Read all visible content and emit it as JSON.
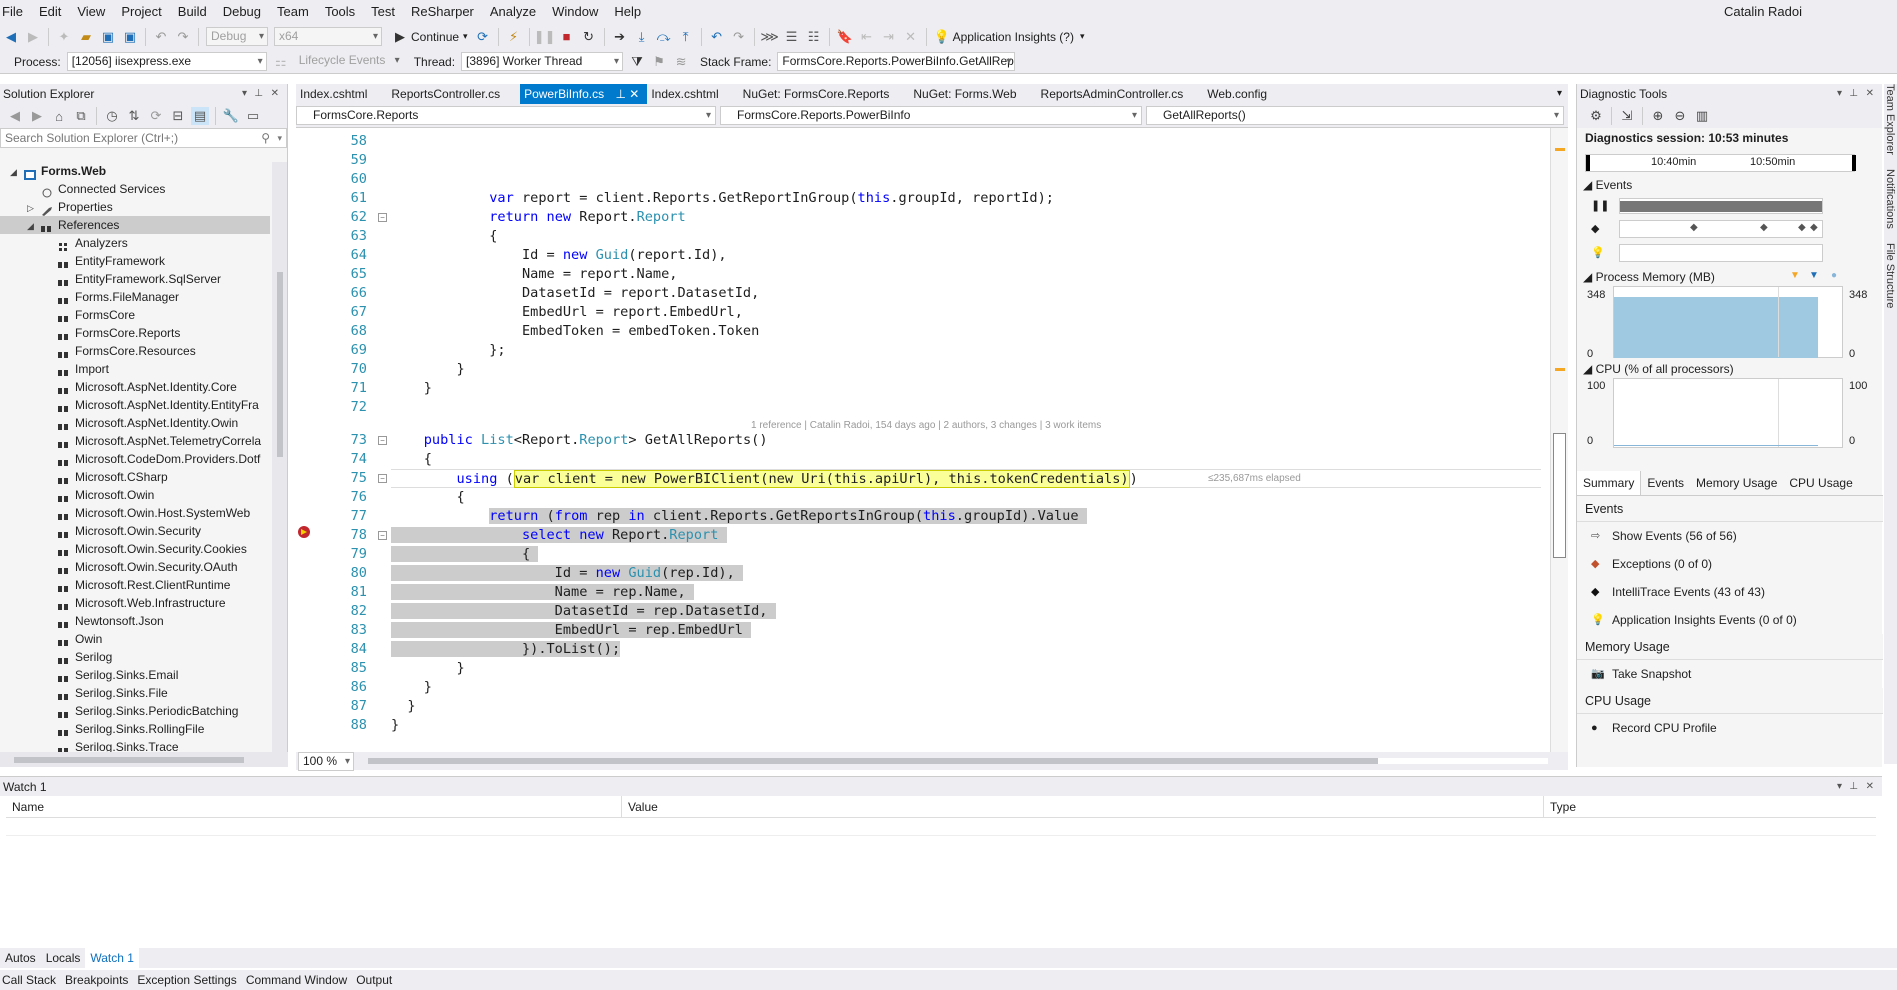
{
  "menu": [
    "File",
    "Edit",
    "View",
    "Project",
    "Build",
    "Debug",
    "Team",
    "Tools",
    "Test",
    "ReSharper",
    "Analyze",
    "Window",
    "Help"
  ],
  "user": "Catalin Radoi",
  "toolbar": {
    "config": "Debug",
    "platform": "x64",
    "continue_label": "Continue",
    "app_insights": "Application Insights (?)",
    "process_label": "Process:",
    "process_value": "[12056] iisexpress.exe",
    "lifecycle": "Lifecycle Events",
    "thread_label": "Thread:",
    "thread_value": "[3896] Worker Thread",
    "stack_label": "Stack Frame:",
    "stack_value": "FormsCore.Reports.PowerBiInfo.GetAllRep"
  },
  "solution_explorer": {
    "title": "Solution Explorer",
    "search_placeholder": "Search Solution Explorer (Ctrl+;)",
    "nodes": [
      {
        "label": "Forms.Web",
        "level": 0,
        "bold": true,
        "icon": "project-icon"
      },
      {
        "label": "Connected Services",
        "level": 1,
        "icon": "connected-services-icon"
      },
      {
        "label": "Properties",
        "level": 1,
        "icon": "properties-icon"
      },
      {
        "label": "References",
        "level": 1,
        "icon": "references-icon",
        "selected": true
      },
      {
        "label": "Analyzers",
        "level": 2,
        "icon": "analyzer-icon"
      },
      {
        "label": "EntityFramework",
        "level": 2,
        "icon": "reference-icon"
      },
      {
        "label": "EntityFramework.SqlServer",
        "level": 2,
        "icon": "reference-icon"
      },
      {
        "label": "Forms.FileManager",
        "level": 2,
        "icon": "reference-icon"
      },
      {
        "label": "FormsCore",
        "level": 2,
        "icon": "reference-icon"
      },
      {
        "label": "FormsCore.Reports",
        "level": 2,
        "icon": "reference-icon"
      },
      {
        "label": "FormsCore.Resources",
        "level": 2,
        "icon": "reference-icon"
      },
      {
        "label": "Import",
        "level": 2,
        "icon": "reference-icon"
      },
      {
        "label": "Microsoft.AspNet.Identity.Core",
        "level": 2,
        "icon": "reference-icon"
      },
      {
        "label": "Microsoft.AspNet.Identity.EntityFra",
        "level": 2,
        "icon": "reference-icon"
      },
      {
        "label": "Microsoft.AspNet.Identity.Owin",
        "level": 2,
        "icon": "reference-icon"
      },
      {
        "label": "Microsoft.AspNet.TelemetryCorrela",
        "level": 2,
        "icon": "reference-icon"
      },
      {
        "label": "Microsoft.CodeDom.Providers.Dotf",
        "level": 2,
        "icon": "reference-icon"
      },
      {
        "label": "Microsoft.CSharp",
        "level": 2,
        "icon": "reference-icon"
      },
      {
        "label": "Microsoft.Owin",
        "level": 2,
        "icon": "reference-icon"
      },
      {
        "label": "Microsoft.Owin.Host.SystemWeb",
        "level": 2,
        "icon": "reference-icon"
      },
      {
        "label": "Microsoft.Owin.Security",
        "level": 2,
        "icon": "reference-icon"
      },
      {
        "label": "Microsoft.Owin.Security.Cookies",
        "level": 2,
        "icon": "reference-icon"
      },
      {
        "label": "Microsoft.Owin.Security.OAuth",
        "level": 2,
        "icon": "reference-icon"
      },
      {
        "label": "Microsoft.Rest.ClientRuntime",
        "level": 2,
        "icon": "reference-icon"
      },
      {
        "label": "Microsoft.Web.Infrastructure",
        "level": 2,
        "icon": "reference-icon"
      },
      {
        "label": "Newtonsoft.Json",
        "level": 2,
        "icon": "reference-icon"
      },
      {
        "label": "Owin",
        "level": 2,
        "icon": "reference-icon"
      },
      {
        "label": "Serilog",
        "level": 2,
        "icon": "reference-icon"
      },
      {
        "label": "Serilog.Sinks.Email",
        "level": 2,
        "icon": "reference-icon"
      },
      {
        "label": "Serilog.Sinks.File",
        "level": 2,
        "icon": "reference-icon"
      },
      {
        "label": "Serilog.Sinks.PeriodicBatching",
        "level": 2,
        "icon": "reference-icon"
      },
      {
        "label": "Serilog.Sinks.RollingFile",
        "level": 2,
        "icon": "reference-icon"
      },
      {
        "label": "Serilog.Sinks.Trace",
        "level": 2,
        "icon": "reference-icon"
      }
    ]
  },
  "tabs": [
    "Index.cshtml",
    "ReportsController.cs",
    "PowerBiInfo.cs",
    "Index.cshtml",
    "NuGet: FormsCore.Reports",
    "NuGet: Forms.Web",
    "ReportsAdminController.cs",
    "Web.config"
  ],
  "active_tab": 2,
  "nav": {
    "project": "FormsCore.Reports",
    "class": "FormsCore.Reports.PowerBiInfo",
    "member": "GetAllReports()"
  },
  "code": [
    {
      "n": "58",
      "tokens": []
    },
    {
      "n": "59",
      "tokens": []
    },
    {
      "n": "60",
      "tokens": []
    },
    {
      "n": "61",
      "tokens": [
        [
          "t",
          "            "
        ],
        [
          "k",
          "var"
        ],
        [
          "t",
          " report = client.Reports.GetReportInGroup("
        ],
        [
          "k",
          "this"
        ],
        [
          "t",
          ".groupId, reportId);"
        ]
      ]
    },
    {
      "n": "62",
      "tokens": [
        [
          "t",
          "            "
        ],
        [
          "k",
          "return"
        ],
        [
          "t",
          " "
        ],
        [
          "k",
          "new"
        ],
        [
          "t",
          " Report."
        ],
        [
          "y",
          "Report"
        ]
      ]
    },
    {
      "n": "63",
      "tokens": [
        [
          "t",
          "            {"
        ]
      ]
    },
    {
      "n": "64",
      "tokens": [
        [
          "t",
          "                Id = "
        ],
        [
          "k",
          "new"
        ],
        [
          "t",
          " "
        ],
        [
          "y",
          "Guid"
        ],
        [
          "t",
          "(report.Id),"
        ]
      ]
    },
    {
      "n": "65",
      "tokens": [
        [
          "t",
          "                Name = report.Name,"
        ]
      ]
    },
    {
      "n": "66",
      "tokens": [
        [
          "t",
          "                DatasetId = report.DatasetId,"
        ]
      ]
    },
    {
      "n": "67",
      "tokens": [
        [
          "t",
          "                EmbedUrl = report.EmbedUrl,"
        ]
      ]
    },
    {
      "n": "68",
      "tokens": [
        [
          "t",
          "                EmbedToken = embedToken.Token"
        ]
      ]
    },
    {
      "n": "69",
      "tokens": [
        [
          "t",
          "            };"
        ]
      ]
    },
    {
      "n": "70",
      "tokens": [
        [
          "t",
          "        }"
        ]
      ]
    },
    {
      "n": "71",
      "tokens": [
        [
          "t",
          "    }"
        ]
      ]
    },
    {
      "n": "72",
      "tokens": []
    },
    {
      "n": "73",
      "tokens": [
        [
          "t",
          "    "
        ],
        [
          "k",
          "public"
        ],
        [
          "t",
          " "
        ],
        [
          "y",
          "List"
        ],
        [
          "t",
          "<Report."
        ],
        [
          "y",
          "Report"
        ],
        [
          "t",
          "> GetAllReports()"
        ]
      ]
    },
    {
      "n": "74",
      "tokens": [
        [
          "t",
          "    {"
        ]
      ]
    },
    {
      "n": "75",
      "tokens": [
        [
          "t",
          "        "
        ],
        [
          "k",
          "using"
        ],
        [
          "t",
          " ("
        ],
        [
          "c",
          "var client = new PowerBIClient(new Uri(this.apiUrl), this.tokenCredentials)"
        ],
        [
          "t",
          ")"
        ]
      ]
    },
    {
      "n": "76",
      "tokens": [
        [
          "t",
          "        {"
        ]
      ]
    },
    {
      "n": "77",
      "tokens": [
        [
          "t",
          "            "
        ],
        [
          "hk",
          "return"
        ],
        [
          "h",
          " ("
        ],
        [
          "hk",
          "from"
        ],
        [
          "h",
          " rep "
        ],
        [
          "hk",
          "in"
        ],
        [
          "h",
          " client.Reports.GetReportsInGroup("
        ],
        [
          "hk",
          "this"
        ],
        [
          "h",
          ".groupId).Value "
        ]
      ]
    },
    {
      "n": "78",
      "tokens": [
        [
          "h",
          "                "
        ],
        [
          "hk",
          "select"
        ],
        [
          "h",
          " "
        ],
        [
          "hk",
          "new"
        ],
        [
          "h",
          " Report."
        ],
        [
          "hy",
          "Report"
        ],
        [
          "h",
          " "
        ]
      ]
    },
    {
      "n": "79",
      "tokens": [
        [
          "h",
          "                { "
        ]
      ]
    },
    {
      "n": "80",
      "tokens": [
        [
          "h",
          "                    Id = "
        ],
        [
          "hk",
          "new"
        ],
        [
          "h",
          " "
        ],
        [
          "hy",
          "Guid"
        ],
        [
          "h",
          "(rep.Id), "
        ]
      ]
    },
    {
      "n": "81",
      "tokens": [
        [
          "h",
          "                    Name = rep.Name, "
        ]
      ]
    },
    {
      "n": "82",
      "tokens": [
        [
          "h",
          "                    DatasetId = rep.DatasetId, "
        ]
      ]
    },
    {
      "n": "83",
      "tokens": [
        [
          "h",
          "                    EmbedUrl = rep.EmbedUrl "
        ]
      ]
    },
    {
      "n": "84",
      "tokens": [
        [
          "h",
          "                }).ToList();"
        ]
      ]
    },
    {
      "n": "85",
      "tokens": [
        [
          "t",
          "        }"
        ]
      ]
    },
    {
      "n": "86",
      "tokens": [
        [
          "t",
          "    }"
        ]
      ]
    },
    {
      "n": "87",
      "tokens": [
        [
          "t",
          "  }"
        ]
      ]
    },
    {
      "n": "88",
      "tokens": [
        [
          "t",
          "}"
        ]
      ]
    }
  ],
  "codelens": "1 reference | Catalin Radoi, 154 days ago | 2 authors, 3 changes | 3 work items",
  "elapsed": "≤235,687ms elapsed",
  "zoom": "100 %",
  "diagnostic": {
    "title": "Diagnostic Tools",
    "session": "Diagnostics session: 10:53 minutes",
    "time1": "10:40min",
    "time2": "10:50min",
    "events_label": "Events",
    "memory_label": "Process Memory (MB)",
    "mem_max": "348",
    "mem_min": "0",
    "cpu_label": "CPU (% of all processors)",
    "cpu_max": "100",
    "cpu_min": "0",
    "tabs": [
      "Summary",
      "Events",
      "Memory Usage",
      "CPU Usage"
    ],
    "events_heading": "Events",
    "rows": [
      {
        "icon": "show-events-icon",
        "label": "Show Events (56 of 56)"
      },
      {
        "icon": "exceptions-icon",
        "label": "Exceptions (0 of 0)"
      },
      {
        "icon": "intellitrace-icon",
        "label": "IntelliTrace Events (43 of 43)"
      },
      {
        "icon": "app-insights-icon",
        "label": "Application Insights Events (0 of 0)"
      }
    ],
    "memory_heading": "Memory Usage",
    "snapshot": "Take Snapshot",
    "cpu_heading": "CPU Usage",
    "record_cpu": "Record CPU Profile",
    "side_tabs": [
      "Team Explorer",
      "Notifications",
      "File Structure"
    ]
  },
  "watch": {
    "title": "Watch 1",
    "cols": [
      "Name",
      "Value",
      "Type"
    ]
  },
  "bottom_tabs": [
    "Autos",
    "Locals",
    "Watch 1"
  ],
  "bottom_tabs2": [
    "Call Stack",
    "Breakpoints",
    "Exception Settings",
    "Command Window",
    "Output"
  ],
  "colors": {
    "accent": "#007acc",
    "keyword": "#0000ff",
    "type": "#2b91af",
    "highlight": "#cccccc",
    "current": "#fbff9a"
  }
}
